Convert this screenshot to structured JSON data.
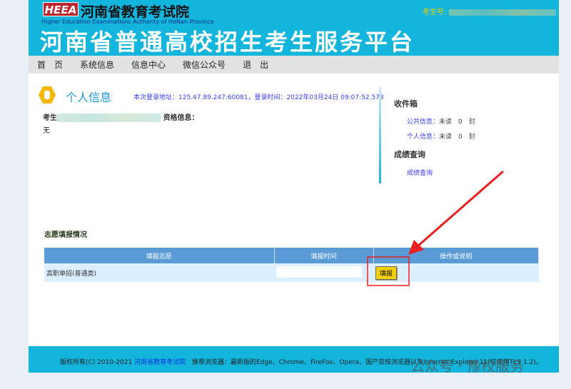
{
  "header": {
    "logo": "HEEA",
    "org_name": "河南省教育考试院",
    "org_name_en": "Higher Education Examinations Authority of HeNan Province",
    "platform_title": "河南省普通高校招生考生服务平台",
    "exam_no_label": "考生号:"
  },
  "nav": [
    "首　页",
    "系统信息",
    "信息中心",
    "微信公众号",
    "退　出"
  ],
  "personal": {
    "title": "个人信息",
    "login_info": "本次登录地址：125.47.89.247:60081，登录时间：2022年03月24日 09:07:52.573",
    "candidate_label": "考生",
    "qualification_label": "资格信息：",
    "qualification_value": "无"
  },
  "inbox": {
    "title": "收件箱",
    "public_label": "公共信息：",
    "public_status": "未读　0　封",
    "personal_label": "个人信息：",
    "personal_status": "未读　0　封"
  },
  "scores": {
    "title": "成绩查询",
    "link": "成绩查询"
  },
  "applications": {
    "title": "志愿填报情况",
    "columns": [
      "填报志愿",
      "填报时间",
      "操作或说明"
    ],
    "rows": [
      {
        "name": "高职单招(普通类)",
        "time": "",
        "action": "填报"
      }
    ]
  },
  "footer": {
    "copyright": "版权所有(C) 2010-2021",
    "org_link": "河南省教育考试院",
    "browsers": "推荐浏览器：最新版的Edge、Chrome、FireFox、Opera、国产双核浏览器以及Internet Explorer 11(仅使用TLS 1.2)。"
  },
  "watermark": "公众号 · 豫校服务",
  "colors": {
    "header": "#13b5dc",
    "annotation": "#e82020",
    "button": "#f5d000"
  }
}
